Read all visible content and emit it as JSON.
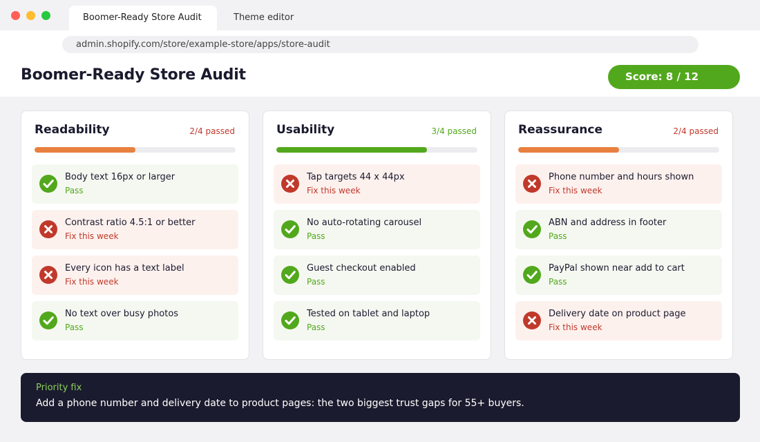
{
  "browser": {
    "tabs": [
      {
        "label": "Boomer-Ready Store Audit",
        "active": true
      },
      {
        "label": "Theme editor",
        "active": false
      }
    ],
    "url": "admin.shopify.com/store/example-store/apps/store-audit"
  },
  "page": {
    "title": "Boomer-Ready Store Audit",
    "score_label": "Score: 8 / 12",
    "score_color": "#52a81c"
  },
  "status_text": {
    "pass": "Pass",
    "fail": "Fix this week"
  },
  "colors": {
    "pass": "#52a81c",
    "fail": "#c0392b",
    "fail_bar": "#e8803f"
  },
  "categories": [
    {
      "title": "Readability",
      "count_label": "2/4 passed",
      "passed": 2,
      "total": 4,
      "items": [
        {
          "label": "Body text 16px or larger",
          "pass": true
        },
        {
          "label": "Contrast ratio 4.5:1 or better",
          "pass": false
        },
        {
          "label": "Every icon has a text label",
          "pass": false
        },
        {
          "label": "No text over busy photos",
          "pass": true
        }
      ]
    },
    {
      "title": "Usability",
      "count_label": "3/4 passed",
      "passed": 3,
      "total": 4,
      "items": [
        {
          "label": "Tap targets 44 x 44px",
          "pass": false
        },
        {
          "label": "No auto-rotating carousel",
          "pass": true
        },
        {
          "label": "Guest checkout enabled",
          "pass": true
        },
        {
          "label": "Tested on tablet and laptop",
          "pass": true
        }
      ]
    },
    {
      "title": "Reassurance",
      "count_label": "2/4 passed",
      "passed": 2,
      "total": 4,
      "items": [
        {
          "label": "Phone number and hours shown",
          "pass": false
        },
        {
          "label": "ABN and address in footer",
          "pass": true
        },
        {
          "label": "PayPal shown near add to cart",
          "pass": true
        },
        {
          "label": "Delivery date on product page",
          "pass": false
        }
      ]
    }
  ],
  "priority": {
    "label": "Priority fix",
    "text": "Add a phone number and delivery date to product pages: the two biggest trust gaps for 55+ buyers."
  }
}
